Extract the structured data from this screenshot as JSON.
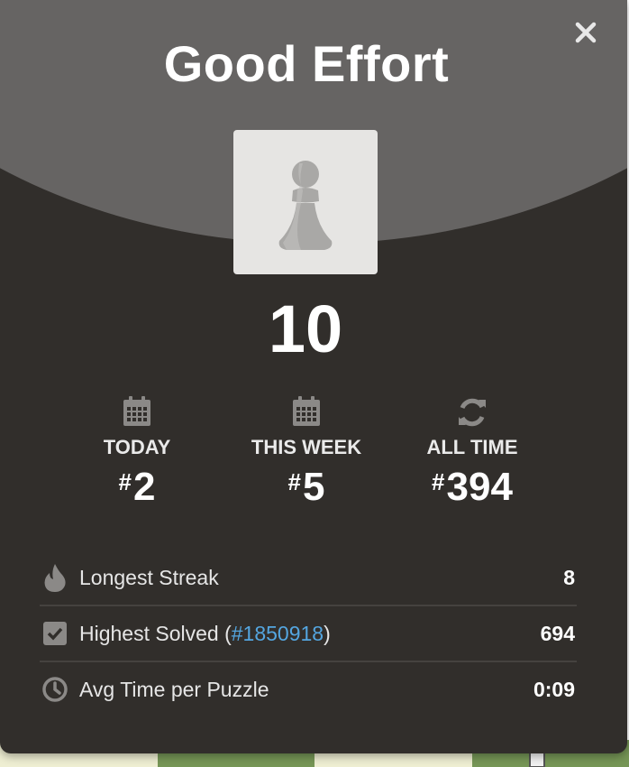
{
  "modal": {
    "title": "Good Effort",
    "close_icon": "close-icon",
    "score": "10",
    "pawn_icon": "pawn-icon"
  },
  "ranks": [
    {
      "label": "TODAY",
      "hash": "#",
      "value": "2",
      "icon": "calendar-icon"
    },
    {
      "label": "THIS WEEK",
      "hash": "#",
      "value": "5",
      "icon": "calendar-icon"
    },
    {
      "label": "ALL TIME",
      "hash": "#",
      "value": "394",
      "icon": "refresh-icon"
    }
  ],
  "stats": [
    {
      "label": "Longest Streak",
      "value": "8",
      "icon": "flame-icon"
    },
    {
      "label_prefix": "Highest Solved (",
      "link": "#1850918",
      "label_suffix": ")",
      "value": "694",
      "icon": "checkbox-icon"
    },
    {
      "label": "Avg Time per Puzzle",
      "value": "0:09",
      "icon": "clock-icon"
    }
  ],
  "colors": {
    "background": "#312e2b",
    "header": "#666463",
    "link": "#54a6e0",
    "board_light": "#eeeed2",
    "board_dark": "#769656"
  }
}
